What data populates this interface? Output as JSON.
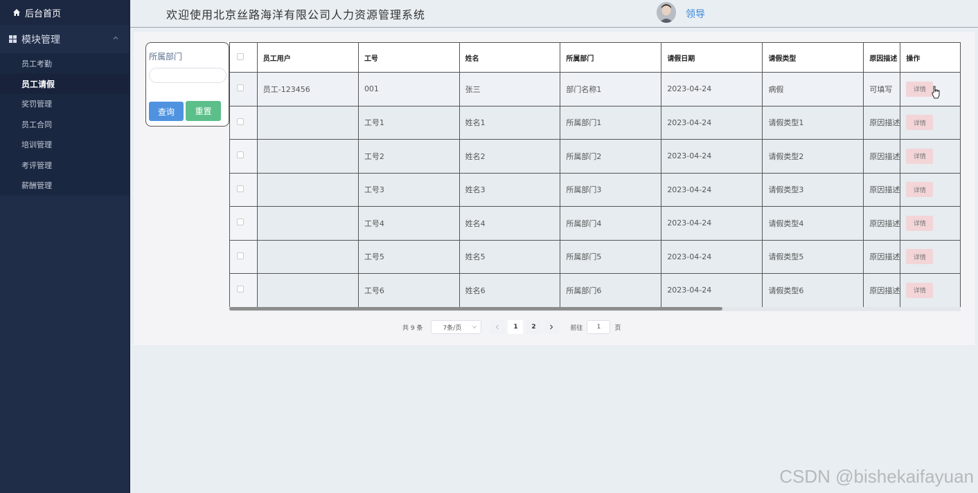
{
  "sidebar": {
    "home": "后台首页",
    "group": "模块管理",
    "items": [
      {
        "label": "员工考勤",
        "active": false
      },
      {
        "label": "员工请假",
        "active": true
      },
      {
        "label": "奖罚管理",
        "active": false
      },
      {
        "label": "员工合同",
        "active": false
      },
      {
        "label": "培训管理",
        "active": false
      },
      {
        "label": "考评管理",
        "active": false
      },
      {
        "label": "薪酬管理",
        "active": false
      }
    ]
  },
  "header": {
    "title": "欢迎使用北京丝路海洋有限公司人力资源管理系统",
    "username": "领导"
  },
  "search": {
    "label": "所属部门",
    "value": "",
    "query_label": "查询",
    "reset_label": "重置"
  },
  "table": {
    "columns": [
      "员工用户",
      "工号",
      "姓名",
      "所属部门",
      "请假日期",
      "请假类型",
      "原因描述",
      "操作"
    ],
    "detail_label": "详情",
    "rows": [
      [
        "员工-123456",
        "001",
        "张三",
        "部门名称1",
        "2023-04-24",
        "病假",
        "可填写"
      ],
      [
        "",
        "工号1",
        "姓名1",
        "所属部门1",
        "2023-04-24",
        "请假类型1",
        "原因描述"
      ],
      [
        "",
        "工号2",
        "姓名2",
        "所属部门2",
        "2023-04-24",
        "请假类型2",
        "原因描述"
      ],
      [
        "",
        "工号3",
        "姓名3",
        "所属部门3",
        "2023-04-24",
        "请假类型3",
        "原因描述"
      ],
      [
        "",
        "工号4",
        "姓名4",
        "所属部门4",
        "2023-04-24",
        "请假类型4",
        "原因描述"
      ],
      [
        "",
        "工号5",
        "姓名5",
        "所属部门5",
        "2023-04-24",
        "请假类型5",
        "原因描述"
      ],
      [
        "",
        "工号6",
        "姓名6",
        "所属部门6",
        "2023-04-24",
        "请假类型6",
        "原因描述"
      ]
    ]
  },
  "pager": {
    "total": "共 9 条",
    "page_size": "7条/页",
    "pages": [
      "1",
      "2"
    ],
    "current": "1",
    "goto_label": "前往",
    "goto_value": "1",
    "page_suffix": "页"
  },
  "watermark": "CSDN @bishekaifayuan"
}
